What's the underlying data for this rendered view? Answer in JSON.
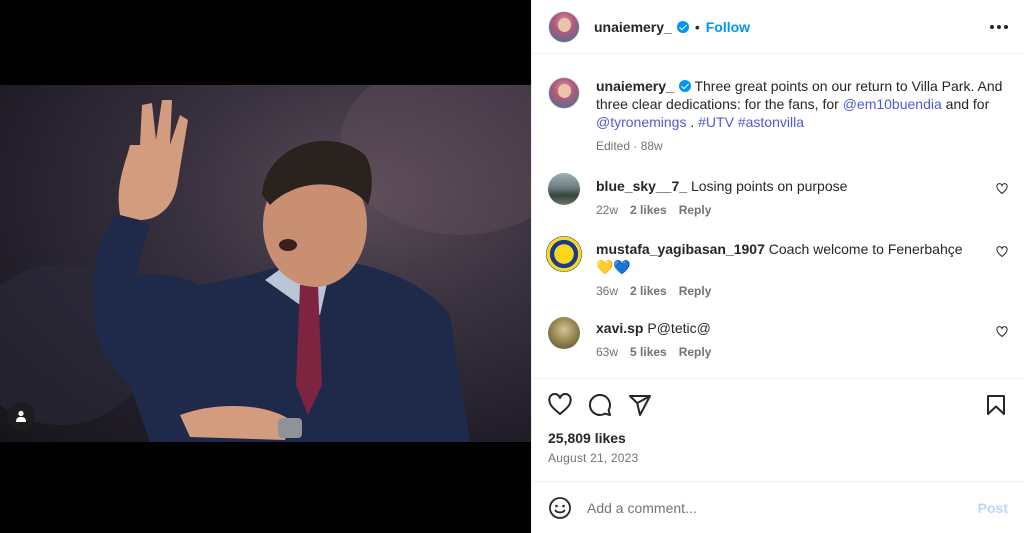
{
  "post": {
    "author": "unaiemery_",
    "follow_label": "Follow",
    "dot": "•"
  },
  "caption": {
    "user": "unaiemery_",
    "text_1": "Three great points on our return to Villa Park. And three clear dedications: for the fans, for ",
    "mention_1": "@em10buendia",
    "text_2": " and for ",
    "mention_2": "@tyronemings",
    "text_3": " . ",
    "hashtag_1": "#UTV",
    "hashtag_2": "#astonvilla",
    "edited": "Edited",
    "time": "88w"
  },
  "comments": [
    {
      "user": "blue_sky__7_",
      "text": "Losing points on purpose",
      "time": "22w",
      "likes": "2 likes",
      "reply": "Reply"
    },
    {
      "user": "mustafa_yagibasan_1907",
      "text": "Coach welcome to Fenerbahçe 💛💙",
      "time": "36w",
      "likes": "2 likes",
      "reply": "Reply"
    },
    {
      "user": "xavi.sp",
      "text": "P@tetic@",
      "time": "63w",
      "likes": "5 likes",
      "reply": "Reply"
    }
  ],
  "stats": {
    "likes": "25,809 likes",
    "date": "August 21, 2023"
  },
  "composer": {
    "placeholder": "Add a comment...",
    "post_label": "Post"
  },
  "icons": {
    "like": "heart-icon",
    "comment": "comment-icon",
    "share": "share-icon",
    "save": "bookmark-icon",
    "emoji": "emoji-icon",
    "tag": "user-tag-icon",
    "more": "more-options-icon"
  },
  "colors": {
    "accent": "#0095f6",
    "link": "#00376b",
    "hashtag": "#4f5bd5",
    "post_disabled": "#b3dbff"
  }
}
